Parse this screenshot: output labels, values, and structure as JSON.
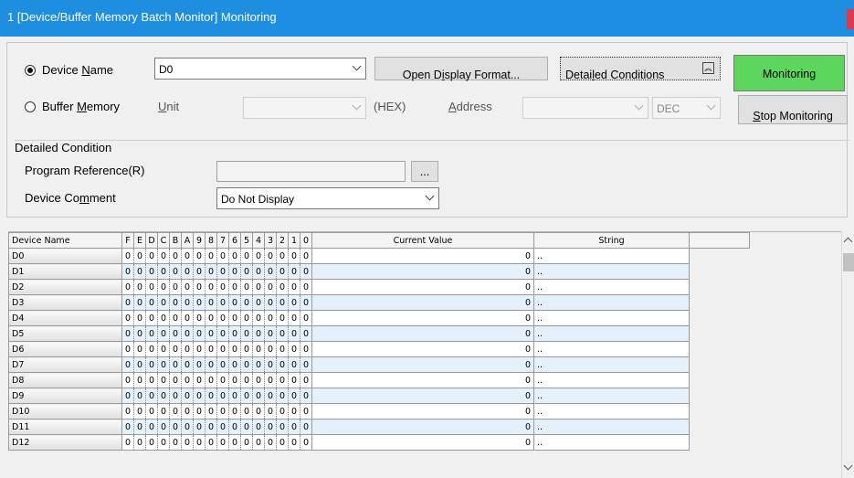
{
  "window": {
    "title": "1 [Device/Buffer Memory Batch Monitor] Monitoring"
  },
  "device_name": {
    "label_pre": "Device ",
    "label_key": "N",
    "label_post": "ame",
    "value": "D0",
    "selected": true
  },
  "open_display_format": {
    "label_pre": "Open D",
    "label_key": "i",
    "label_post": "splay Format..."
  },
  "detailed_conditions": {
    "label_pre": "Detai",
    "label_key": "l",
    "label_post": "ed Conditions",
    "icon": "collapse-up-icon"
  },
  "monitoring_button": {
    "label": "Monitoring",
    "color": "#5cd65c"
  },
  "stop_monitoring_button": {
    "label_key": "S",
    "label_post": "top Monitoring"
  },
  "buffer_memory": {
    "label_pre": "Buffer ",
    "label_key": "M",
    "label_post": "emory",
    "selected": false
  },
  "unit": {
    "label_key": "U",
    "label_post": "nit",
    "value": "",
    "suffix": "(HEX)"
  },
  "address": {
    "label_key": "A",
    "label_post": "ddress",
    "value": "",
    "format": "DEC"
  },
  "detailed_condition": {
    "heading": "Detailed Condition",
    "program_reference": {
      "label": "Program Reference(R)",
      "value": "",
      "browse": "..."
    },
    "device_comment": {
      "label_pre": "Device Co",
      "label_key": "m",
      "label_post": "ment",
      "value": "Do Not Display"
    }
  },
  "grid": {
    "headers": {
      "device": "Device Name",
      "bits": [
        "F",
        "E",
        "D",
        "C",
        "B",
        "A",
        "9",
        "8",
        "7",
        "6",
        "5",
        "4",
        "3",
        "2",
        "1",
        "0"
      ],
      "current": "Current Value",
      "string": "String"
    },
    "rows": [
      {
        "device": "D0",
        "bits": [
          "0",
          "0",
          "0",
          "0",
          "0",
          "0",
          "0",
          "0",
          "0",
          "0",
          "0",
          "0",
          "0",
          "0",
          "0",
          "0"
        ],
        "current": "0",
        "string": ".."
      },
      {
        "device": "D1",
        "bits": [
          "0",
          "0",
          "0",
          "0",
          "0",
          "0",
          "0",
          "0",
          "0",
          "0",
          "0",
          "0",
          "0",
          "0",
          "0",
          "0"
        ],
        "current": "0",
        "string": ".."
      },
      {
        "device": "D2",
        "bits": [
          "0",
          "0",
          "0",
          "0",
          "0",
          "0",
          "0",
          "0",
          "0",
          "0",
          "0",
          "0",
          "0",
          "0",
          "0",
          "0"
        ],
        "current": "0",
        "string": ".."
      },
      {
        "device": "D3",
        "bits": [
          "0",
          "0",
          "0",
          "0",
          "0",
          "0",
          "0",
          "0",
          "0",
          "0",
          "0",
          "0",
          "0",
          "0",
          "0",
          "0"
        ],
        "current": "0",
        "string": ".."
      },
      {
        "device": "D4",
        "bits": [
          "0",
          "0",
          "0",
          "0",
          "0",
          "0",
          "0",
          "0",
          "0",
          "0",
          "0",
          "0",
          "0",
          "0",
          "0",
          "0"
        ],
        "current": "0",
        "string": ".."
      },
      {
        "device": "D5",
        "bits": [
          "0",
          "0",
          "0",
          "0",
          "0",
          "0",
          "0",
          "0",
          "0",
          "0",
          "0",
          "0",
          "0",
          "0",
          "0",
          "0"
        ],
        "current": "0",
        "string": ".."
      },
      {
        "device": "D6",
        "bits": [
          "0",
          "0",
          "0",
          "0",
          "0",
          "0",
          "0",
          "0",
          "0",
          "0",
          "0",
          "0",
          "0",
          "0",
          "0",
          "0"
        ],
        "current": "0",
        "string": ".."
      },
      {
        "device": "D7",
        "bits": [
          "0",
          "0",
          "0",
          "0",
          "0",
          "0",
          "0",
          "0",
          "0",
          "0",
          "0",
          "0",
          "0",
          "0",
          "0",
          "0"
        ],
        "current": "0",
        "string": ".."
      },
      {
        "device": "D8",
        "bits": [
          "0",
          "0",
          "0",
          "0",
          "0",
          "0",
          "0",
          "0",
          "0",
          "0",
          "0",
          "0",
          "0",
          "0",
          "0",
          "0"
        ],
        "current": "0",
        "string": ".."
      },
      {
        "device": "D9",
        "bits": [
          "0",
          "0",
          "0",
          "0",
          "0",
          "0",
          "0",
          "0",
          "0",
          "0",
          "0",
          "0",
          "0",
          "0",
          "0",
          "0"
        ],
        "current": "0",
        "string": ".."
      },
      {
        "device": "D10",
        "bits": [
          "0",
          "0",
          "0",
          "0",
          "0",
          "0",
          "0",
          "0",
          "0",
          "0",
          "0",
          "0",
          "0",
          "0",
          "0",
          "0"
        ],
        "current": "0",
        "string": ".."
      },
      {
        "device": "D11",
        "bits": [
          "0",
          "0",
          "0",
          "0",
          "0",
          "0",
          "0",
          "0",
          "0",
          "0",
          "0",
          "0",
          "0",
          "0",
          "0",
          "0"
        ],
        "current": "0",
        "string": ".."
      },
      {
        "device": "D12",
        "bits": [
          "0",
          "0",
          "0",
          "0",
          "0",
          "0",
          "0",
          "0",
          "0",
          "0",
          "0",
          "0",
          "0",
          "0",
          "0",
          "0"
        ],
        "current": "0",
        "string": ".."
      }
    ]
  }
}
